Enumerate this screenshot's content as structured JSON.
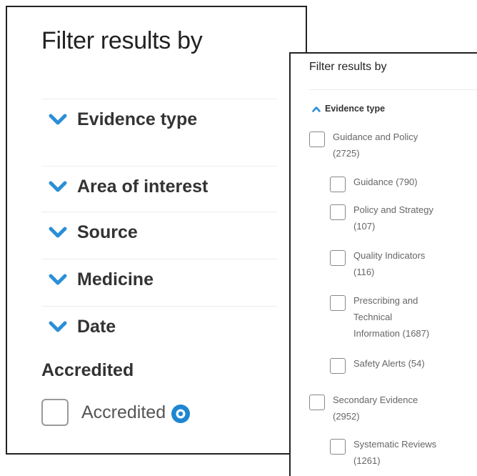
{
  "left_panel": {
    "title": "Filter results by",
    "sections": [
      {
        "label": "Evidence type"
      },
      {
        "label": "Area of interest"
      },
      {
        "label": "Source"
      },
      {
        "label": "Medicine"
      },
      {
        "label": "Date"
      }
    ],
    "accredited_heading": "Accredited",
    "accredited_label": "Accredited",
    "info_icon": "info-circle-icon",
    "chevron_icon": "chevron-down-icon"
  },
  "right_panel": {
    "title": "Filter results by",
    "section_label": "Evidence type",
    "section_icon": "chevron-up-icon",
    "items": [
      {
        "text": "Guidance and Policy\n(2725)"
      },
      {
        "text": "Guidance (790)"
      },
      {
        "text": "Policy and Strategy\n(107)"
      },
      {
        "text": "Quality Indicators\n(116)"
      },
      {
        "text": "Prescribing and\nTechnical\nInformation (1687)"
      },
      {
        "text": "Safety Alerts (54)"
      },
      {
        "text": "Secondary Evidence\n(2952)"
      },
      {
        "text": "Systematic Reviews\n(1261)"
      }
    ]
  },
  "colors": {
    "accent": "#2b8fd6",
    "text_dark": "#333333",
    "text_muted": "#666666",
    "border": "#222222"
  }
}
